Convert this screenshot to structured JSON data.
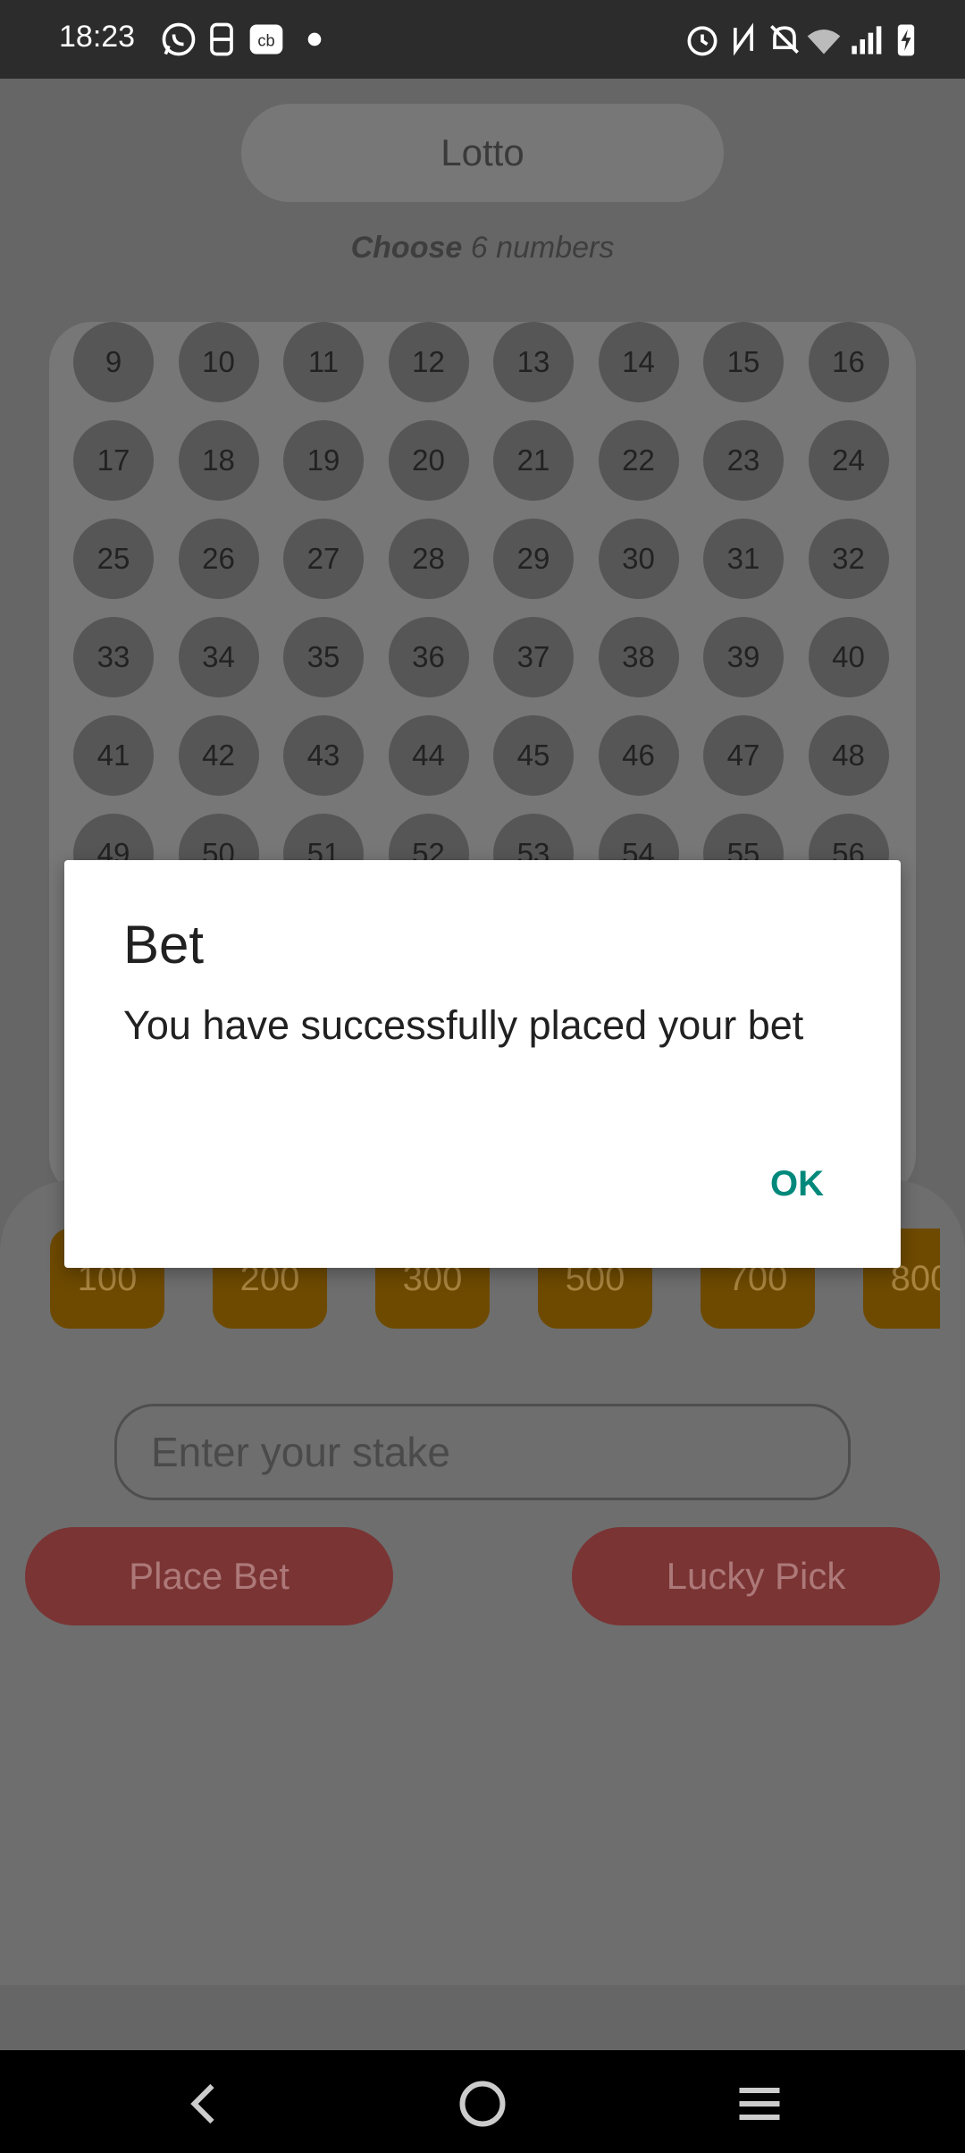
{
  "status_bar": {
    "time": "18:23",
    "left_icons": [
      "whatsapp-icon",
      "app-icon",
      "cb-icon",
      "dot-icon"
    ],
    "right_icons": [
      "alarm-icon",
      "nfc-icon",
      "bell-off-icon",
      "wifi-icon",
      "signal-icon",
      "battery-charging-icon"
    ]
  },
  "app": {
    "game_title": "Lotto",
    "instruction_bold": "Choose",
    "instruction_rest": " 6 numbers",
    "numbers": [
      "9",
      "10",
      "11",
      "12",
      "13",
      "14",
      "15",
      "16",
      "17",
      "18",
      "19",
      "20",
      "21",
      "22",
      "23",
      "24",
      "25",
      "26",
      "27",
      "28",
      "29",
      "30",
      "31",
      "32",
      "33",
      "34",
      "35",
      "36",
      "37",
      "38",
      "39",
      "40",
      "41",
      "42",
      "43",
      "44",
      "45",
      "46",
      "47",
      "48",
      "49",
      "50",
      "51",
      "52",
      "53",
      "54",
      "55",
      "56"
    ],
    "stake_chips": [
      "100",
      "200",
      "300",
      "500",
      "700",
      "800"
    ],
    "stake_placeholder": "Enter your stake",
    "place_bet_label": "Place Bet",
    "lucky_pick_label": "Lucky Pick"
  },
  "dialog": {
    "title": "Bet",
    "message": "You have successfully placed your bet",
    "ok_label": "OK"
  },
  "colors": {
    "accent": "#00897b",
    "chip": "#6e4a00",
    "button": "#7a3434"
  }
}
